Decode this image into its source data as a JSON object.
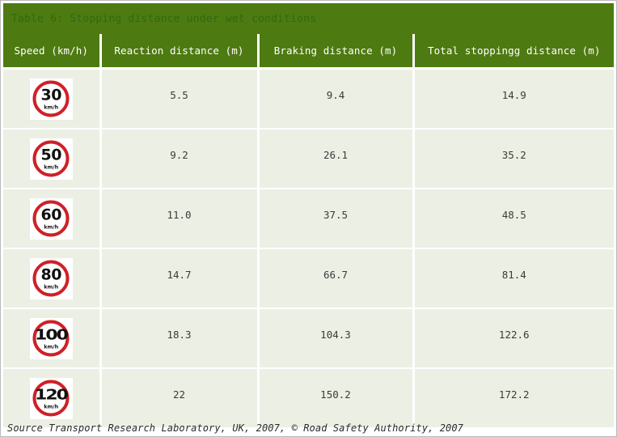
{
  "table": {
    "title": "Table 6: Stopping distance under wet conditions",
    "columns": [
      "Speed (km/h)",
      "Reaction distance (m)",
      "Braking distance (m)",
      "Total stoppingg distance (m)"
    ],
    "rows": [
      {
        "speed": "30",
        "unit": "km/h",
        "reaction": "5.5",
        "braking": "9.4",
        "total": "14.9"
      },
      {
        "speed": "50",
        "unit": "km/h",
        "reaction": "9.2",
        "braking": "26.1",
        "total": "35.2"
      },
      {
        "speed": "60",
        "unit": "km/h",
        "reaction": "11.0",
        "braking": "37.5",
        "total": "48.5"
      },
      {
        "speed": "80",
        "unit": "km/h",
        "reaction": "14.7",
        "braking": "66.7",
        "total": "81.4"
      },
      {
        "speed": "100",
        "unit": "km/h",
        "reaction": "18.3",
        "braking": "104.3",
        "total": "122.6"
      },
      {
        "speed": "120",
        "unit": "km/h",
        "reaction": "22",
        "braking": "150.2",
        "total": "172.2"
      }
    ]
  },
  "source": "Source Transport Research Laboratory, UK, 2007, © Road Safety Authority, 2007",
  "colors": {
    "header_green": "#4e7a12",
    "title_text": "#2d6b0e",
    "cell_background": "#ecefe4",
    "sign_red": "#cf2027",
    "grid_line": "#ffffff"
  }
}
